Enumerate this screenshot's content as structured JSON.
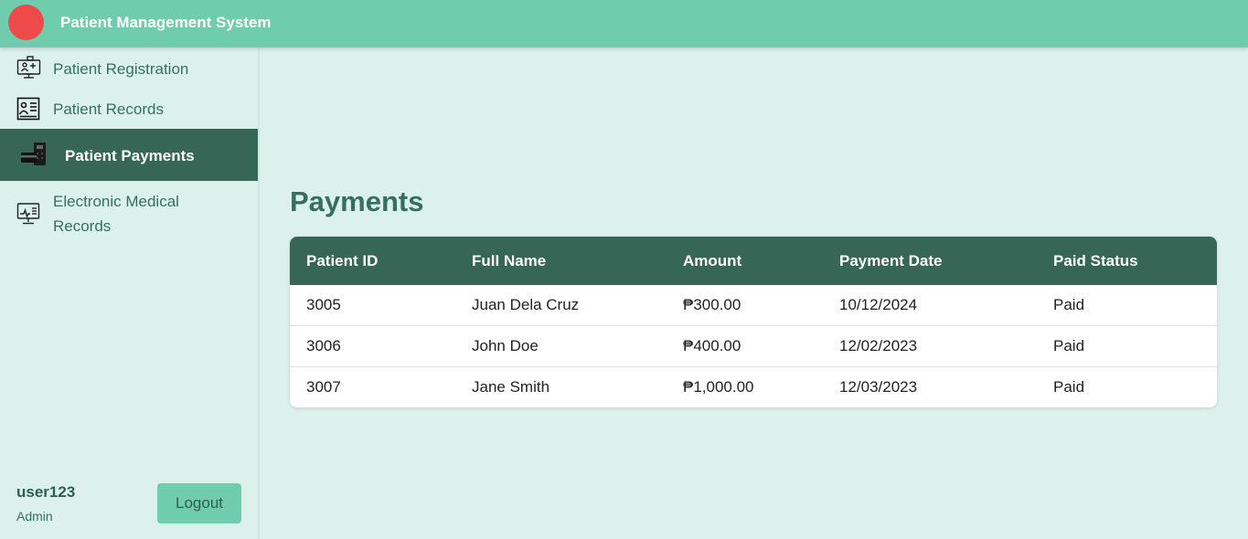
{
  "app": {
    "title": "Patient Management System"
  },
  "sidebar": {
    "items": [
      {
        "label": "Patient Registration",
        "icon": "registration-icon"
      },
      {
        "label": "Patient Records",
        "icon": "records-icon"
      },
      {
        "label": "Patient Payments",
        "icon": "payments-icon",
        "active": true
      },
      {
        "label_line1": "Electronic Medical",
        "label_line2": "Records",
        "icon": "medical-monitor-icon"
      }
    ],
    "user": {
      "name": "user123",
      "role": "Admin"
    },
    "logout_label": "Logout"
  },
  "main": {
    "title": "Payments",
    "table": {
      "headers": [
        "Patient ID",
        "Full Name",
        "Amount",
        "Payment Date",
        "Paid Status"
      ],
      "rows": [
        [
          "3005",
          "Juan Dela Cruz",
          "₱300.00",
          "10/12/2024",
          "Paid"
        ],
        [
          "3006",
          "John Doe",
          "₱400.00",
          "12/02/2023",
          "Paid"
        ],
        [
          "3007",
          "Jane Smith",
          "₱1,000.00",
          "12/03/2023",
          "Paid"
        ]
      ]
    }
  },
  "colors": {
    "topbar": "#6fcdad",
    "accent_dark": "#356656",
    "background": "#ddf1ec",
    "logo": "#ef4a4a"
  }
}
